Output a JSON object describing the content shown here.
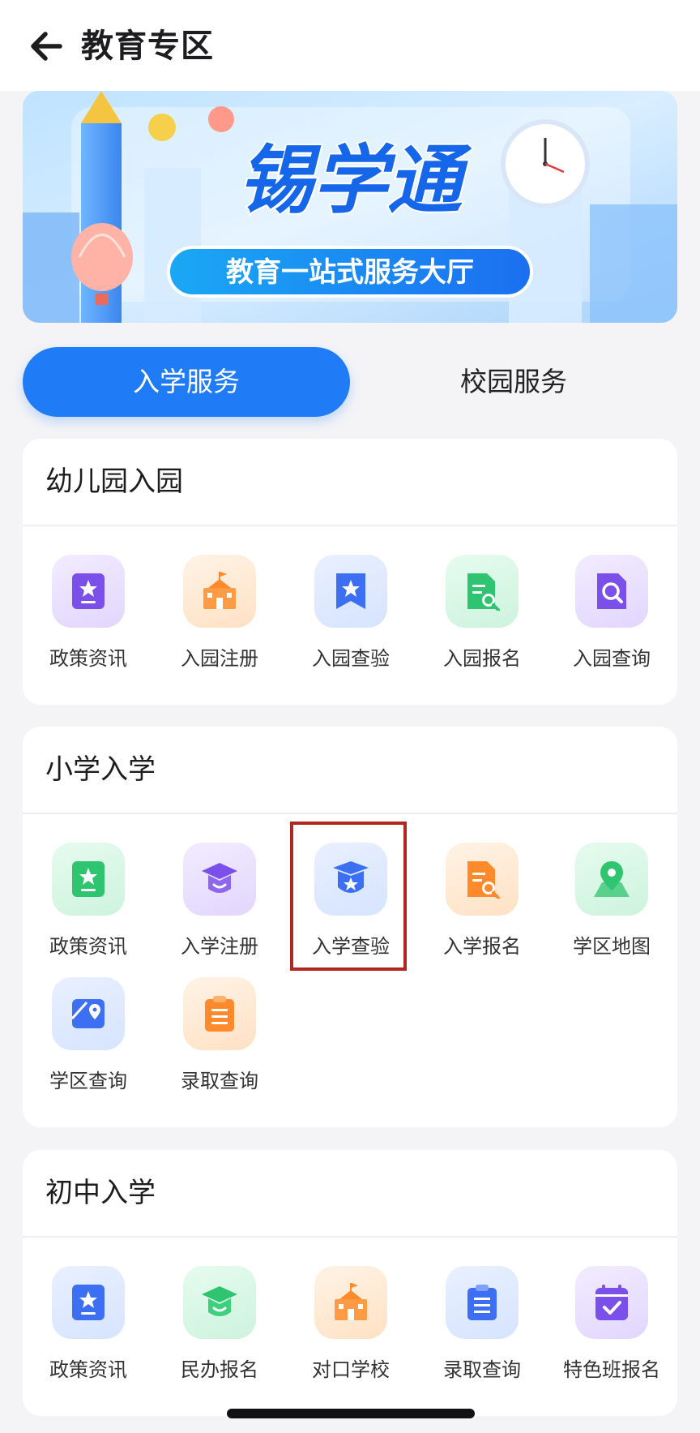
{
  "header": {
    "title": "教育专区"
  },
  "banner": {
    "brand": "锡学通",
    "subtitle": "教育一站式服务大厅"
  },
  "tabs": [
    {
      "label": "入学服务",
      "active": true
    },
    {
      "label": "校园服务",
      "active": false
    }
  ],
  "sections": [
    {
      "title": "幼儿园入园",
      "items": [
        {
          "label": "政策资讯",
          "icon": "document-star-icon",
          "color": "purple"
        },
        {
          "label": "入园注册",
          "icon": "school-building-icon",
          "color": "orange"
        },
        {
          "label": "入园查验",
          "icon": "bookmark-star-icon",
          "color": "blue"
        },
        {
          "label": "入园报名",
          "icon": "document-search-icon",
          "color": "green"
        },
        {
          "label": "入园查询",
          "icon": "search-document-icon",
          "color": "purple"
        }
      ]
    },
    {
      "title": "小学入学",
      "items": [
        {
          "label": "政策资讯",
          "icon": "document-star-icon",
          "color": "green"
        },
        {
          "label": "入学注册",
          "icon": "graduation-cap-icon",
          "color": "purple"
        },
        {
          "label": "入学查验",
          "icon": "shield-star-icon",
          "color": "blue"
        },
        {
          "label": "入学报名",
          "icon": "document-search-icon",
          "color": "orange"
        },
        {
          "label": "学区地图",
          "icon": "map-pin-icon",
          "color": "green"
        },
        {
          "label": "学区查询",
          "icon": "map-location-icon",
          "color": "blue"
        },
        {
          "label": "录取查询",
          "icon": "clipboard-list-icon",
          "color": "orange"
        }
      ]
    },
    {
      "title": "初中入学",
      "items": [
        {
          "label": "政策资讯",
          "icon": "document-star-icon",
          "color": "blue"
        },
        {
          "label": "民办报名",
          "icon": "graduation-cap-icon",
          "color": "green"
        },
        {
          "label": "对口学校",
          "icon": "school-building-icon",
          "color": "orange"
        },
        {
          "label": "录取查询",
          "icon": "clipboard-list-icon",
          "color": "blue"
        },
        {
          "label": "特色班报名",
          "icon": "calendar-check-icon",
          "color": "purple"
        }
      ]
    }
  ],
  "colors": {
    "accent": "#1f7cf6",
    "highlight_border": "#b0271f",
    "purple": "#7b4fea",
    "orange": "#ff8a2b",
    "blue": "#3d6ff2",
    "green": "#2fc46f"
  }
}
